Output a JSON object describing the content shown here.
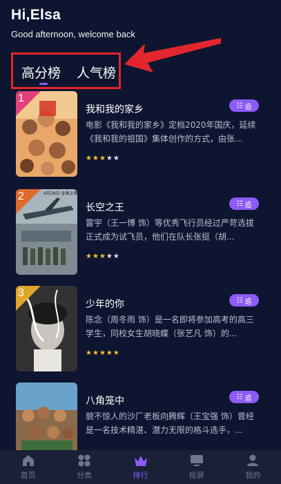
{
  "header": {
    "greeting": "Hi,Elsa",
    "subtitle": "Good afternoon, welcome back"
  },
  "tabs": [
    {
      "label": "高分榜",
      "active": true
    },
    {
      "label": "人气榜",
      "active": false
    }
  ],
  "accent_color": "#8b5cf6",
  "highlight_color": "#e3262d",
  "movies": [
    {
      "rank": "1",
      "rank_color": "#e0427b",
      "title": "我和我的家乡",
      "description": "电影《我和我的家乡》定档2020年国庆，延续《我和我的祖国》集体创作的方式，由张...",
      "rating": 3,
      "max_rating": 5,
      "follow_label": "追",
      "poster_icon": "movie-poster"
    },
    {
      "rank": "2",
      "rank_color": "#e06a2a",
      "title": "长空之王",
      "description": "雷宇（王一博 饰）等优秀飞行员经过严苛选拔正式成为试飞员，他们在队长张挺（胡...",
      "rating": 3,
      "max_rating": 5,
      "follow_label": "追",
      "poster_icon": "movie-poster"
    },
    {
      "rank": "3",
      "rank_color": "#e0a62a",
      "title": "少年的你",
      "description": "陈念（周冬雨 饰）是一名即将参加高考的高三学生，同校女生胡晓蝶（张艺凡 饰）的...",
      "rating": 5,
      "max_rating": 5,
      "follow_label": "追",
      "poster_icon": "movie-poster"
    },
    {
      "rank": "",
      "rank_color": "",
      "title": "八角笼中",
      "description": "貌不惊人的沙厂老板向腾辉（王宝强 饰）曾经是一名技术精湛、潜力无限的格斗选手，...",
      "rating": 0,
      "max_rating": 5,
      "follow_label": "追",
      "poster_icon": "movie-poster"
    }
  ],
  "poster_texts": {
    "poster2_date": "4月28日 全国上映"
  },
  "tabbar": [
    {
      "label": "首页",
      "icon": "home-icon",
      "active": false
    },
    {
      "label": "分类",
      "icon": "category-icon",
      "active": false
    },
    {
      "label": "排行",
      "icon": "crown-icon",
      "active": true
    },
    {
      "label": "投屏",
      "icon": "cast-icon",
      "active": false
    },
    {
      "label": "我的",
      "icon": "user-icon",
      "active": false
    }
  ]
}
